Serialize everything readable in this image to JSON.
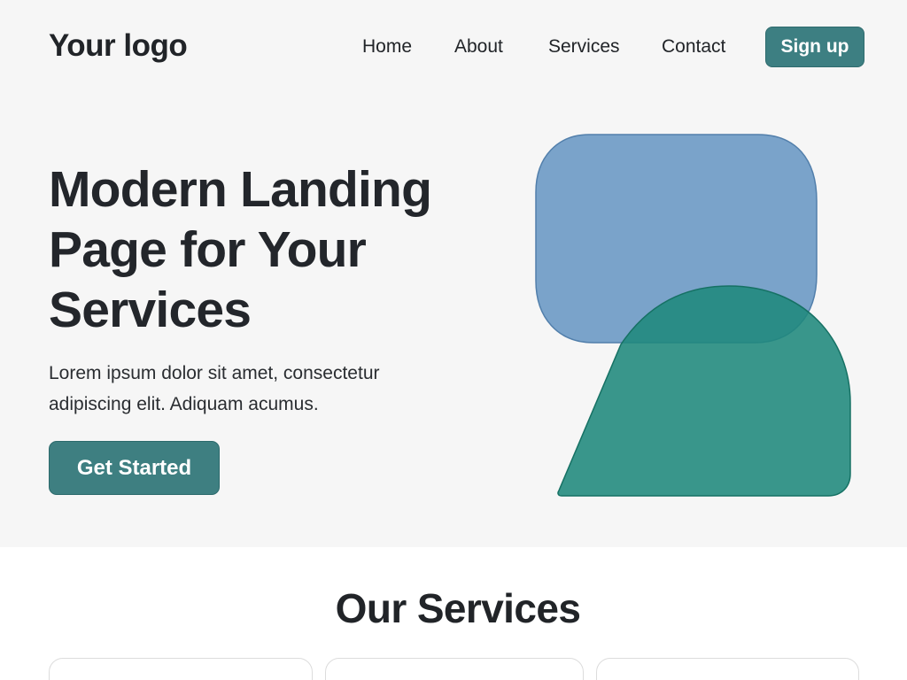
{
  "header": {
    "logo": "Your logo",
    "nav": {
      "home": "Home",
      "about": "About",
      "services": "Services",
      "contact": "Contact"
    },
    "signup_label": "Sign up"
  },
  "hero": {
    "title": "Modern Landing Page for Your Services",
    "text": "Lorem ipsum dolor sit amet, consectetur adipiscing elit. Adiquam acumus.",
    "cta_label": "Get Started",
    "graphic": {
      "blue_shape_color": "#6f9bc6",
      "teal_shape_color": "#1f897c"
    }
  },
  "services": {
    "title": "Our Services"
  },
  "colors": {
    "accent": "#3d7f82",
    "hero_background": "#f6f6f6",
    "text": "#23262b"
  }
}
